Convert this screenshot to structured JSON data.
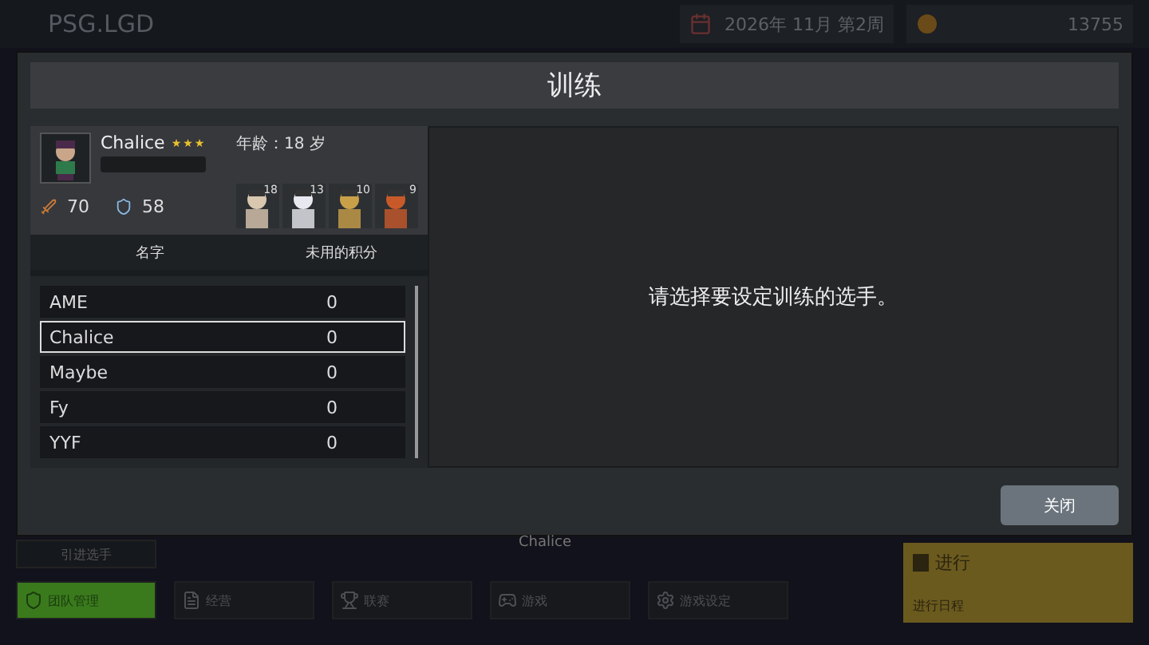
{
  "top_bar": {
    "team_name": "PSG.LGD",
    "date": "2026年 11月 第2周",
    "money": "13755"
  },
  "dialog": {
    "title": "训练",
    "close_button": "关闭",
    "player_card": {
      "name": "Chalice",
      "stars": 3,
      "age": "年龄：18 岁",
      "attack": "70",
      "defense": "58",
      "heroes": [
        {
          "count": "18"
        },
        {
          "count": "13"
        },
        {
          "count": "10"
        },
        {
          "count": "9"
        }
      ]
    },
    "table": {
      "columns": [
        "名字",
        "未用的积分"
      ],
      "rows": [
        {
          "name": "AME",
          "points": "0",
          "selected": false
        },
        {
          "name": "Chalice",
          "points": "0",
          "selected": true
        },
        {
          "name": "Maybe",
          "points": "0",
          "selected": false
        },
        {
          "name": "Fy",
          "points": "0",
          "selected": false
        },
        {
          "name": "YYF",
          "points": "0",
          "selected": false
        }
      ]
    },
    "message": "请选择要设定训练的选手。"
  },
  "behind_label": "Chalice",
  "recruit_button": "引进选手",
  "nav": [
    {
      "label": "团队管理",
      "selected": true
    },
    {
      "label": "经营",
      "selected": false
    },
    {
      "label": "联赛",
      "selected": false
    },
    {
      "label": "游戏",
      "selected": false
    },
    {
      "label": "游戏设定",
      "selected": false
    }
  ],
  "proceed": {
    "title": "进行",
    "subtitle": "进行日程"
  }
}
